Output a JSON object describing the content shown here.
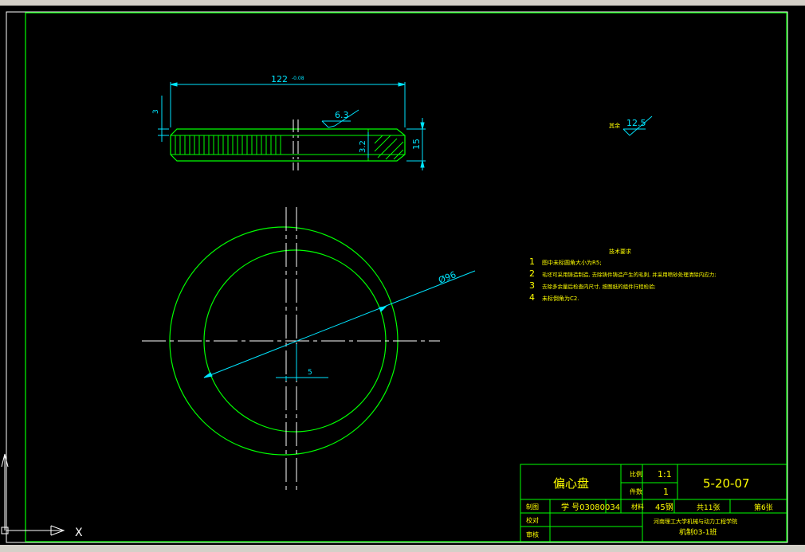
{
  "drawing": {
    "part_name": "偏心盘",
    "drawing_number": "5-20-07",
    "scale_label": "比例",
    "scale_value": "1:1",
    "quantity_label": "件数",
    "quantity_value": "1",
    "drawn_label": "制图",
    "drawn_value": "学  号03080034",
    "material_label": "材料",
    "material_value": "45钢",
    "sheets_total": "共11张",
    "sheet_no": "第6张",
    "check_label": "校对",
    "review_label": "审核",
    "school": "河南理工大学机械与动力工程学院",
    "class": "机制03-1班"
  },
  "dims": {
    "width": "122",
    "width_tol": "-0.08",
    "left_tol": "3",
    "roughness_face": "6.3",
    "chamfer": "3.2",
    "height": "15",
    "diameter": "Ø96",
    "offset": "5",
    "rest_label": "其余",
    "rest_roughness": "12.5"
  },
  "notes": {
    "title": "技术要求",
    "items": [
      {
        "num": "1",
        "text": "图中未标圆角大小为R5;"
      },
      {
        "num": "2",
        "text": "毛坯可采用铸造制造, 去除铸件铸造产生的毛刺, 并采用喷砂处理清除内应力;"
      },
      {
        "num": "3",
        "text": "去除多余量后检查内尺寸, 按图纸的组件行程检验;"
      },
      {
        "num": "4",
        "text": "未标倒角为C2."
      }
    ]
  },
  "ucs": {
    "x_label": "X",
    "y_label": "Y"
  },
  "colors": {
    "background": "#000000",
    "border": "#00ff00",
    "outline": "#00ff00",
    "dimension": "#00e5ff",
    "centerline": "#ffffff",
    "text_yellow": "#ffff00",
    "text_white": "#ffffff"
  }
}
